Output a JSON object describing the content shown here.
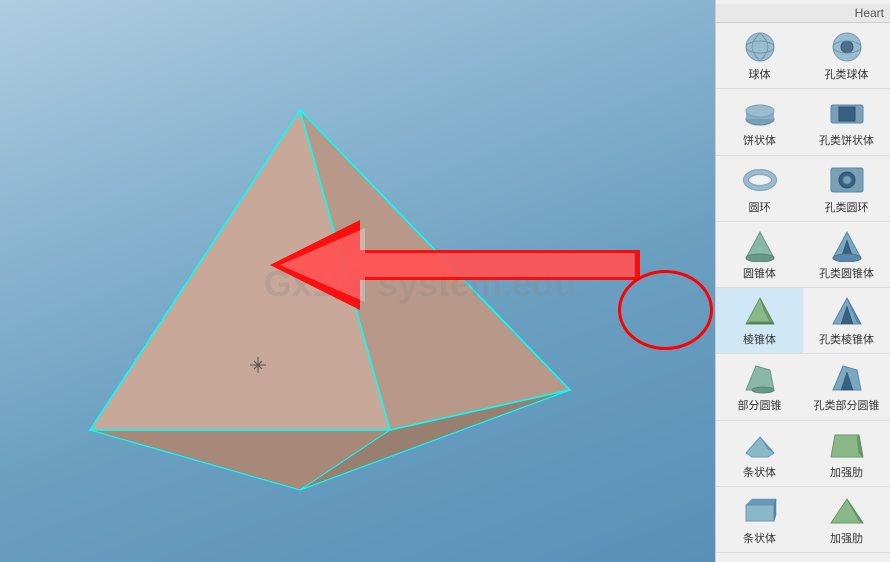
{
  "viewport": {
    "watermark": "Gx1网 system.edu"
  },
  "header": {
    "heart_label": "Heart"
  },
  "sidebar": {
    "rows": [
      {
        "items": [
          {
            "id": "sphere",
            "label": "球体",
            "icon": "sphere"
          },
          {
            "id": "hole-sphere",
            "label": "孔类球体",
            "icon": "hole-sphere"
          }
        ]
      },
      {
        "items": [
          {
            "id": "pie",
            "label": "饼状体",
            "icon": "pie"
          },
          {
            "id": "hole-pie",
            "label": "孔类饼状体",
            "icon": "hole-pie"
          }
        ]
      },
      {
        "items": [
          {
            "id": "torus",
            "label": "圆环",
            "icon": "torus"
          },
          {
            "id": "hole-torus",
            "label": "孔类圆环",
            "icon": "hole-torus"
          }
        ]
      },
      {
        "items": [
          {
            "id": "cone",
            "label": "圆锥体",
            "icon": "cone"
          },
          {
            "id": "hole-cone",
            "label": "孔类圆锥体",
            "icon": "hole-cone"
          }
        ]
      },
      {
        "items": [
          {
            "id": "prism",
            "label": "棱锥体",
            "icon": "prism",
            "highlighted": true
          },
          {
            "id": "hole-prism",
            "label": "孔类棱锥体",
            "icon": "hole-prism"
          }
        ]
      },
      {
        "items": [
          {
            "id": "partial-cone",
            "label": "部分圆锥",
            "icon": "partial-cone"
          },
          {
            "id": "hole-partial-cone",
            "label": "孔类部分圆锥",
            "icon": "hole-partial-cone"
          }
        ]
      },
      {
        "items": [
          {
            "id": "bar",
            "label": "条状体",
            "icon": "bar"
          },
          {
            "id": "rib",
            "label": "加强肋",
            "icon": "rib"
          }
        ]
      },
      {
        "items": [
          {
            "id": "bar2",
            "label": "条状体",
            "icon": "bar2"
          },
          {
            "id": "rib2",
            "label": "加强肋",
            "icon": "rib2"
          }
        ]
      }
    ]
  }
}
